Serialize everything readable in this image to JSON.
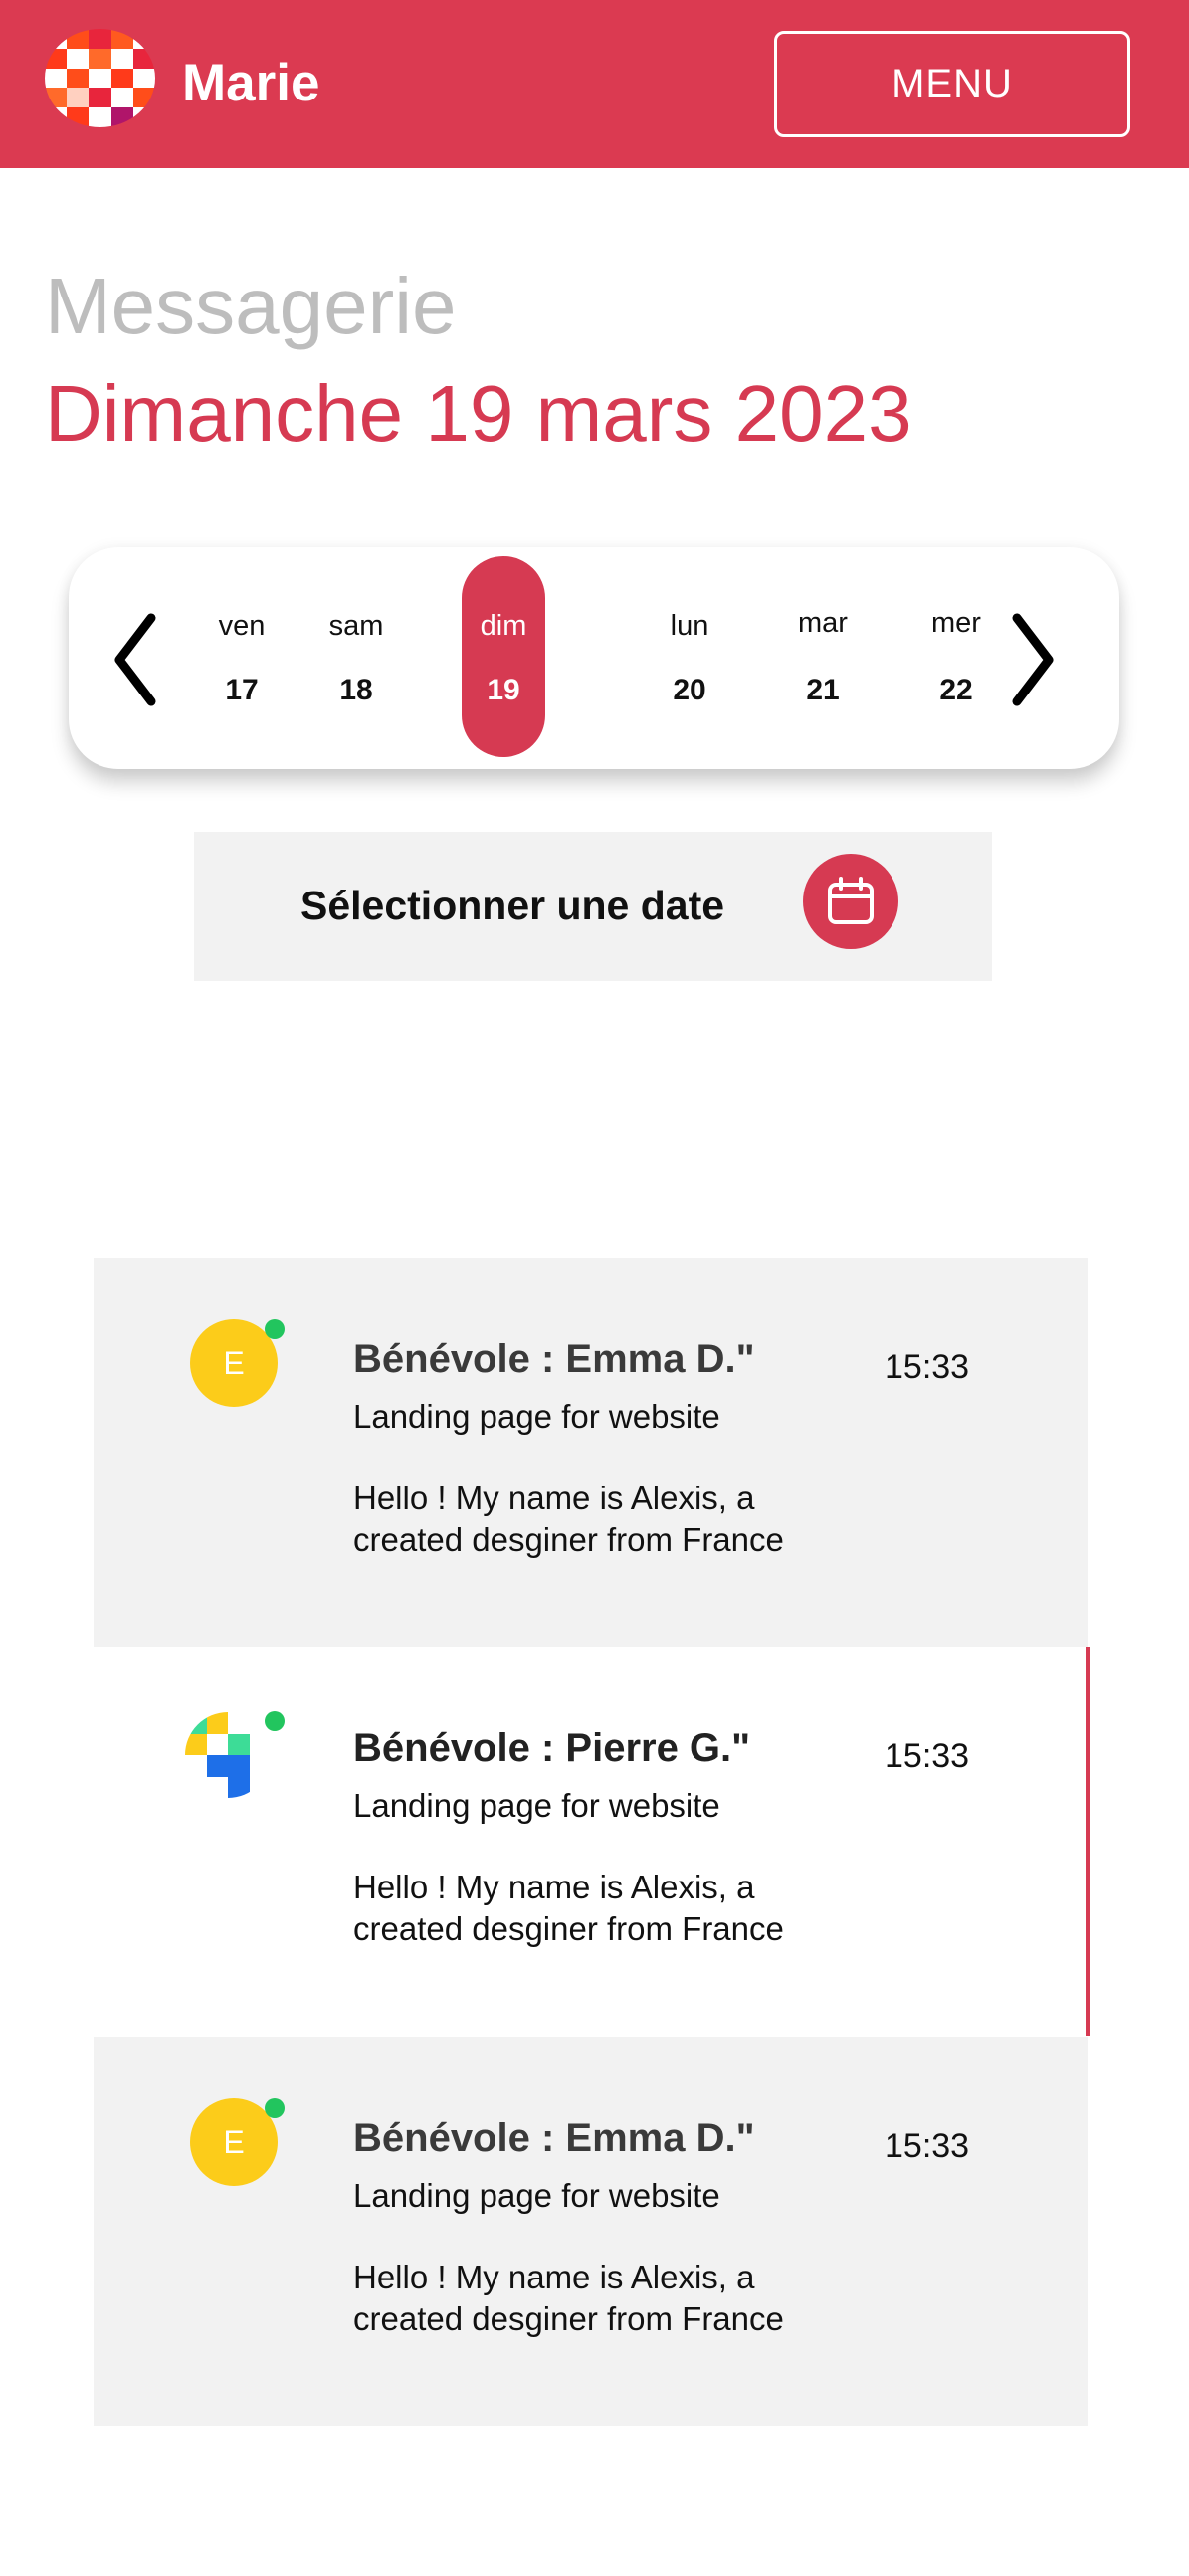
{
  "header": {
    "app_name": "Marie",
    "menu_label": "MENU",
    "brand_color": "#db3a51",
    "logo_icon": "checkered-logo-icon"
  },
  "page": {
    "section_label": "Messagerie",
    "current_date": "Dimanche 19 mars 2023"
  },
  "day_strip": {
    "prev_icon": "chevron-left-icon",
    "next_icon": "chevron-right-icon",
    "days": [
      {
        "name": "ven",
        "number": "17",
        "selected": false
      },
      {
        "name": "sam",
        "number": "18",
        "selected": false
      },
      {
        "name": "dim",
        "number": "19",
        "selected": true
      },
      {
        "name": "lun",
        "number": "20",
        "selected": false
      },
      {
        "name": "mar",
        "number": "21",
        "selected": false
      },
      {
        "name": "mer",
        "number": "22",
        "selected": false
      }
    ]
  },
  "date_picker": {
    "label": "Sélectionner une date",
    "icon": "calendar-icon"
  },
  "messages": [
    {
      "sender": "Bénévole : Emma D.\"",
      "time": "15:33",
      "subject": "Landing page for website",
      "preview": "Hello ! My name is Alexis, a created desginer from France",
      "avatar_initial": "E",
      "online": true,
      "active": false
    },
    {
      "sender": "Bénévole : Pierre G.\"",
      "time": "15:33",
      "subject": "Landing page for website",
      "preview": "Hello ! My name is Alexis, a created desginer from France",
      "avatar_initial": "",
      "online": true,
      "active": true
    },
    {
      "sender": "Bénévole : Emma D.\"",
      "time": "15:33",
      "subject": "Landing page for website",
      "preview": "Hello ! My name is Alexis, a created desginer from France",
      "avatar_initial": "E",
      "online": true,
      "active": false
    }
  ]
}
